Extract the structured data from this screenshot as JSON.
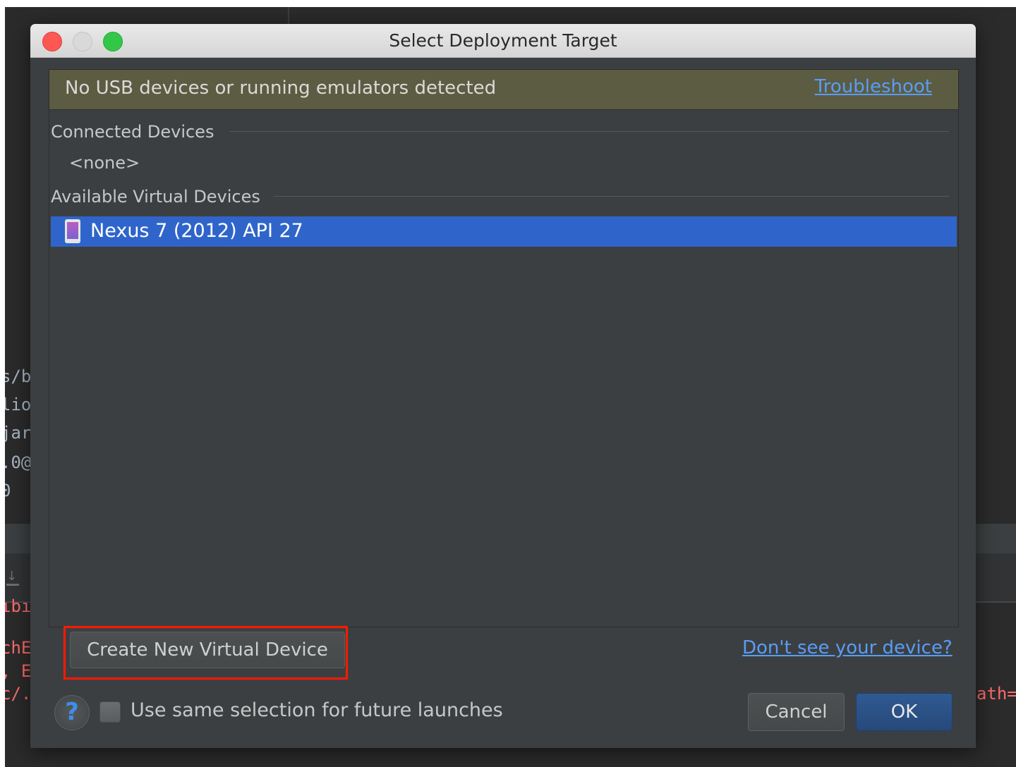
{
  "window": {
    "title": "Select Deployment Target"
  },
  "banner": {
    "message": "No USB devices or running emulators detected",
    "troubleshoot_link": "Troubleshoot"
  },
  "connected_devices": {
    "heading": "Connected Devices",
    "empty_text": "<none>"
  },
  "virtual_devices": {
    "heading": "Available Virtual Devices",
    "items": [
      {
        "label": "Nexus 7 (2012) API 27",
        "icon": "phone-device-icon",
        "selected": true
      }
    ]
  },
  "footer": {
    "create_button": "Create New Virtual Device",
    "dont_see_link": "Don't see your device?",
    "help_glyph": "?",
    "same_selection_label": "Use same selection for future launches",
    "same_selection_checked": false,
    "cancel_button": "Cancel",
    "ok_button": "OK"
  },
  "background_code": {
    "lines": [
      "s/b",
      "lio.",
      "jar",
      ".0@",
      "0",
      "ıbı",
      "chE",
      ", E",
      "c/."
    ],
    "right_fragment": "ath="
  },
  "colors": {
    "selection": "#2f65ca",
    "banner": "#5c5c42",
    "link": "#589df6",
    "highlight": "#ff1a00"
  }
}
